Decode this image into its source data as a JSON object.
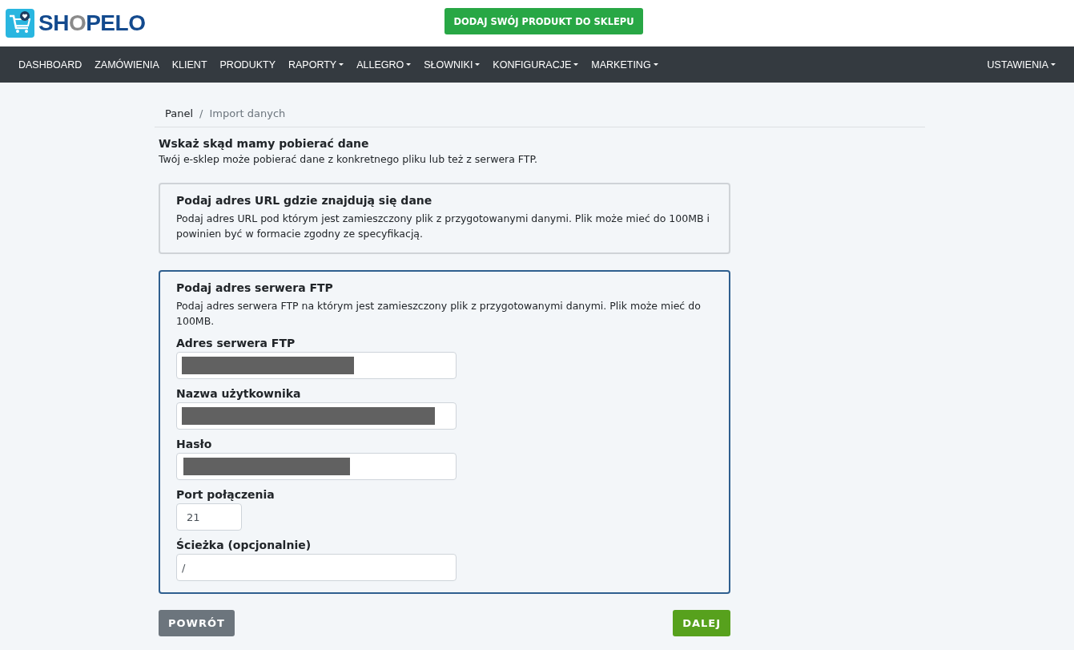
{
  "header": {
    "logo": [
      {
        "text": "SH",
        "kind": "main"
      },
      {
        "text": "O",
        "kind": "accent"
      },
      {
        "text": "PELO",
        "kind": "main"
      }
    ],
    "cta_button": "DODAJ SWÓJ PRODUKT DO SKLEPU"
  },
  "nav": {
    "items": [
      {
        "label": "DASHBOARD",
        "dropdown": false
      },
      {
        "label": "ZAMÓWIENIA",
        "dropdown": false
      },
      {
        "label": "KLIENT",
        "dropdown": false
      },
      {
        "label": "PRODUKTY",
        "dropdown": false
      },
      {
        "label": "RAPORTY",
        "dropdown": true
      },
      {
        "label": "ALLEGRO",
        "dropdown": true
      },
      {
        "label": "SŁOWNIKI",
        "dropdown": true
      },
      {
        "label": "KONFIGURACJE",
        "dropdown": true
      },
      {
        "label": "MARKETING",
        "dropdown": true
      }
    ],
    "right": {
      "label": "USTAWIENIA",
      "dropdown": true
    }
  },
  "breadcrumb": {
    "items": [
      "Panel",
      "Import danych"
    ],
    "separator": "/"
  },
  "section": {
    "title": "Wskaż skąd mamy pobierać dane",
    "description": "Twój e-sklep może pobierać dane z konkretnego pliku lub też z serwera FTP."
  },
  "options": [
    {
      "title": "Podaj adres URL gdzie znajdują się dane",
      "description": "Podaj adres URL pod którym jest zamieszczony plik z przygotowanymi danymi. Plik może mieć do 100MB i powinien być w formacie zgodny ze specyfikacją.",
      "selected": false
    },
    {
      "title": "Podaj adres serwera FTP",
      "description": "Podaj adres serwera FTP na którym jest zamieszczony plik z przygotowanymi danymi. Plik może mieć do 100MB.",
      "selected": true
    }
  ],
  "ftp_fields": [
    {
      "label": "Adres serwera FTP",
      "redacted": true,
      "kind": "text"
    },
    {
      "label": "Nazwa użytkownika",
      "redacted": true,
      "kind": "text"
    },
    {
      "label": "Hasło",
      "redacted": true,
      "kind": "password"
    },
    {
      "label": "Port połączenia",
      "value": "21",
      "redacted": false,
      "kind": "number"
    },
    {
      "label": "Ścieżka (opcjonalnie)",
      "value": "/",
      "redacted": false,
      "kind": "text"
    }
  ],
  "buttons": {
    "back": "POWRÓT",
    "next": "DALEJ"
  }
}
